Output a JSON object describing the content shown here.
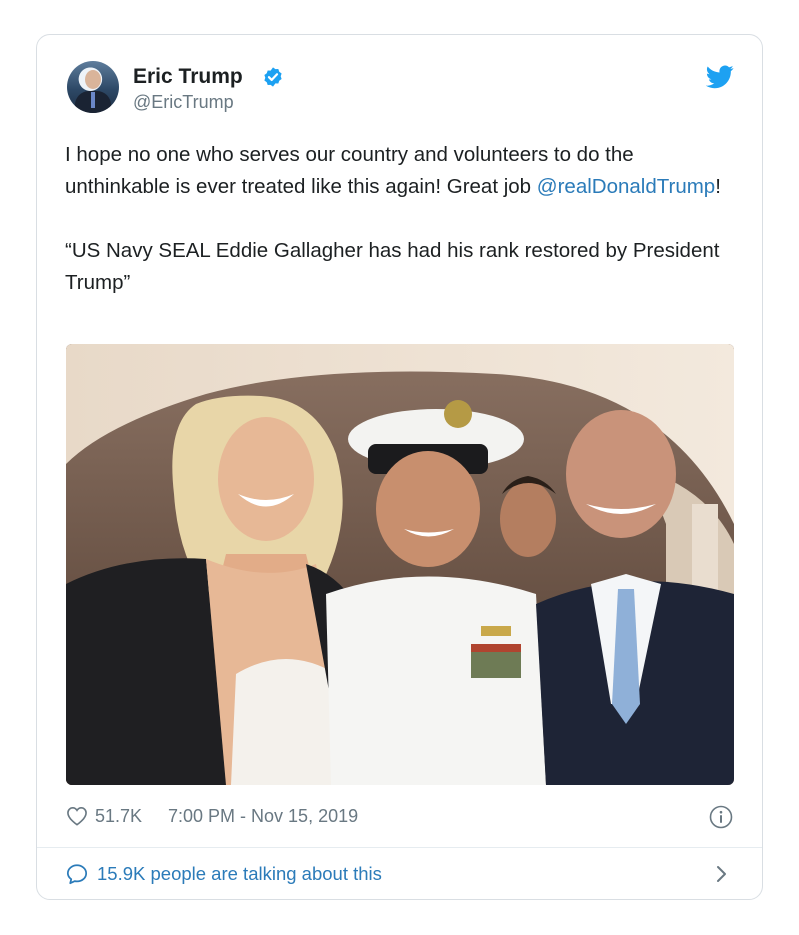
{
  "tweet": {
    "author": {
      "name": "Eric Trump",
      "handle": "@EricTrump",
      "verified": true
    },
    "text_line1": "I hope no one who serves our country and volunteers to do the unthinkable is  ever treated like this again! Great job ",
    "mention": "@realDonaldTrump",
    "text_after_mention": "!",
    "quote": "“US Navy SEAL Eddie Gallagher has had his rank restored by President Trump”",
    "likes": "51.7K",
    "timestamp": "7:00 PM - Nov 15, 2019",
    "talking": "15.9K people are talking about this"
  },
  "icons": {
    "brand": "twitter-bird-icon",
    "verified": "verified-badge-icon",
    "like": "heart-icon",
    "info": "info-icon",
    "reply": "speech-bubble-icon",
    "more": "chevron-right-icon"
  },
  "colors": {
    "accent": "#1da1f2",
    "link": "#2b7bb9",
    "muted": "#697882",
    "text": "#1c2022",
    "border": "#d9dee3"
  }
}
